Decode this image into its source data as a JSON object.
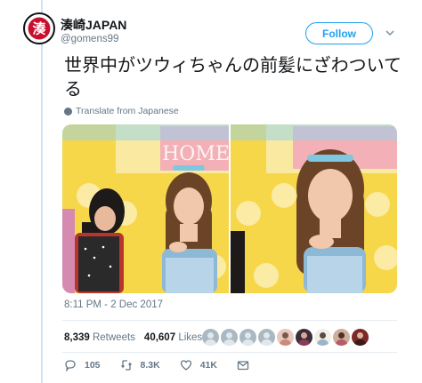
{
  "user": {
    "display_name": "湊崎JAPAN",
    "handle": "@gomens99",
    "avatar_glyph": "湊"
  },
  "follow_label": "Follow",
  "tweet_text": "世界中がツウィちゃんの前髪にざわついてる",
  "translate_label": "Translate from Japanese",
  "media": {
    "overlay_text": "HOME"
  },
  "timestamp": "8:11 PM - 2 Dec 2017",
  "stats": {
    "retweets_count": "8,339",
    "retweets_label": "Retweets",
    "likes_count": "40,607",
    "likes_label": "Likes"
  },
  "actions": {
    "replies": "105",
    "retweets": "8.3K",
    "likes": "41K"
  },
  "colors": {
    "accent": "#1da1f2",
    "secondary_text": "#657786",
    "rail": "#cfe3f5"
  }
}
